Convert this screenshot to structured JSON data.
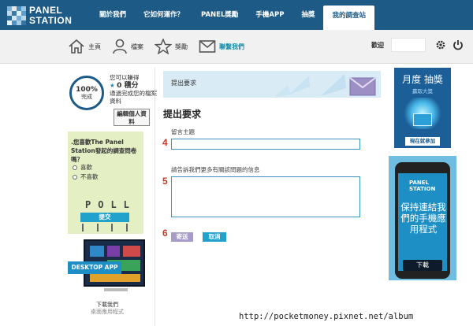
{
  "logo": {
    "line1": "PANEL",
    "line2": "STATION"
  },
  "topnav": {
    "items": [
      "關於我們",
      "它如何運作？",
      "PANEL獎勵",
      "手機APP",
      "抽獎",
      "我的調查站"
    ],
    "active_index": 5
  },
  "subnav": {
    "items": [
      {
        "label": "主頁",
        "icon": "home-icon"
      },
      {
        "label": "檔案",
        "icon": "user-icon"
      },
      {
        "label": "獎勵",
        "icon": "star-icon"
      },
      {
        "label": "聯繫我們",
        "icon": "envelope-icon"
      }
    ],
    "active_index": 3
  },
  "user": {
    "welcome": "歡迎",
    "settings_icon": "gear-icon",
    "logout_icon": "power-icon"
  },
  "profile": {
    "progress_value": "100%",
    "progress_label": "完成",
    "points_line1": "您可以賺得",
    "points_value": "0 積分",
    "points_line2": "通過完成您的檔案資料",
    "edit_button": "編輯個人資料"
  },
  "poll": {
    "question": ".您喜歡The Panel Station發起的調查問卷嗎？",
    "options": [
      "喜歡",
      "不喜歡"
    ],
    "word": "POLL",
    "submit": "提交"
  },
  "desktop_app": {
    "banner": "DESKTOP APP",
    "caption": "下載我們",
    "caption_faint": "桌面應用程式"
  },
  "form": {
    "banner_title": "提出要求",
    "heading": "提出要求",
    "subject_label": "留言主題",
    "subject_value": "",
    "message_label": "請告訴我們更多有關該問題的信息",
    "message_value": "",
    "send": "寄送",
    "cancel": "取消",
    "step_subject": "4",
    "step_message": "5",
    "step_buttons": "6"
  },
  "lottery": {
    "title": "月度 抽獎",
    "sub": "贏取大獎",
    "button": "現在就參加"
  },
  "mobile_app": {
    "logo_line1": "PANEL",
    "logo_line2": "STATION",
    "text": "保持連結我們的手機應用程式",
    "button": "下載"
  },
  "watermark": "http://pocketmoney.pixnet.net/album",
  "colors": {
    "brand": "#1d5b86",
    "accent": "#1a8fa8",
    "button": "#20a2cc",
    "poll_bg": "#e4efc4",
    "step": "#c0392b"
  }
}
